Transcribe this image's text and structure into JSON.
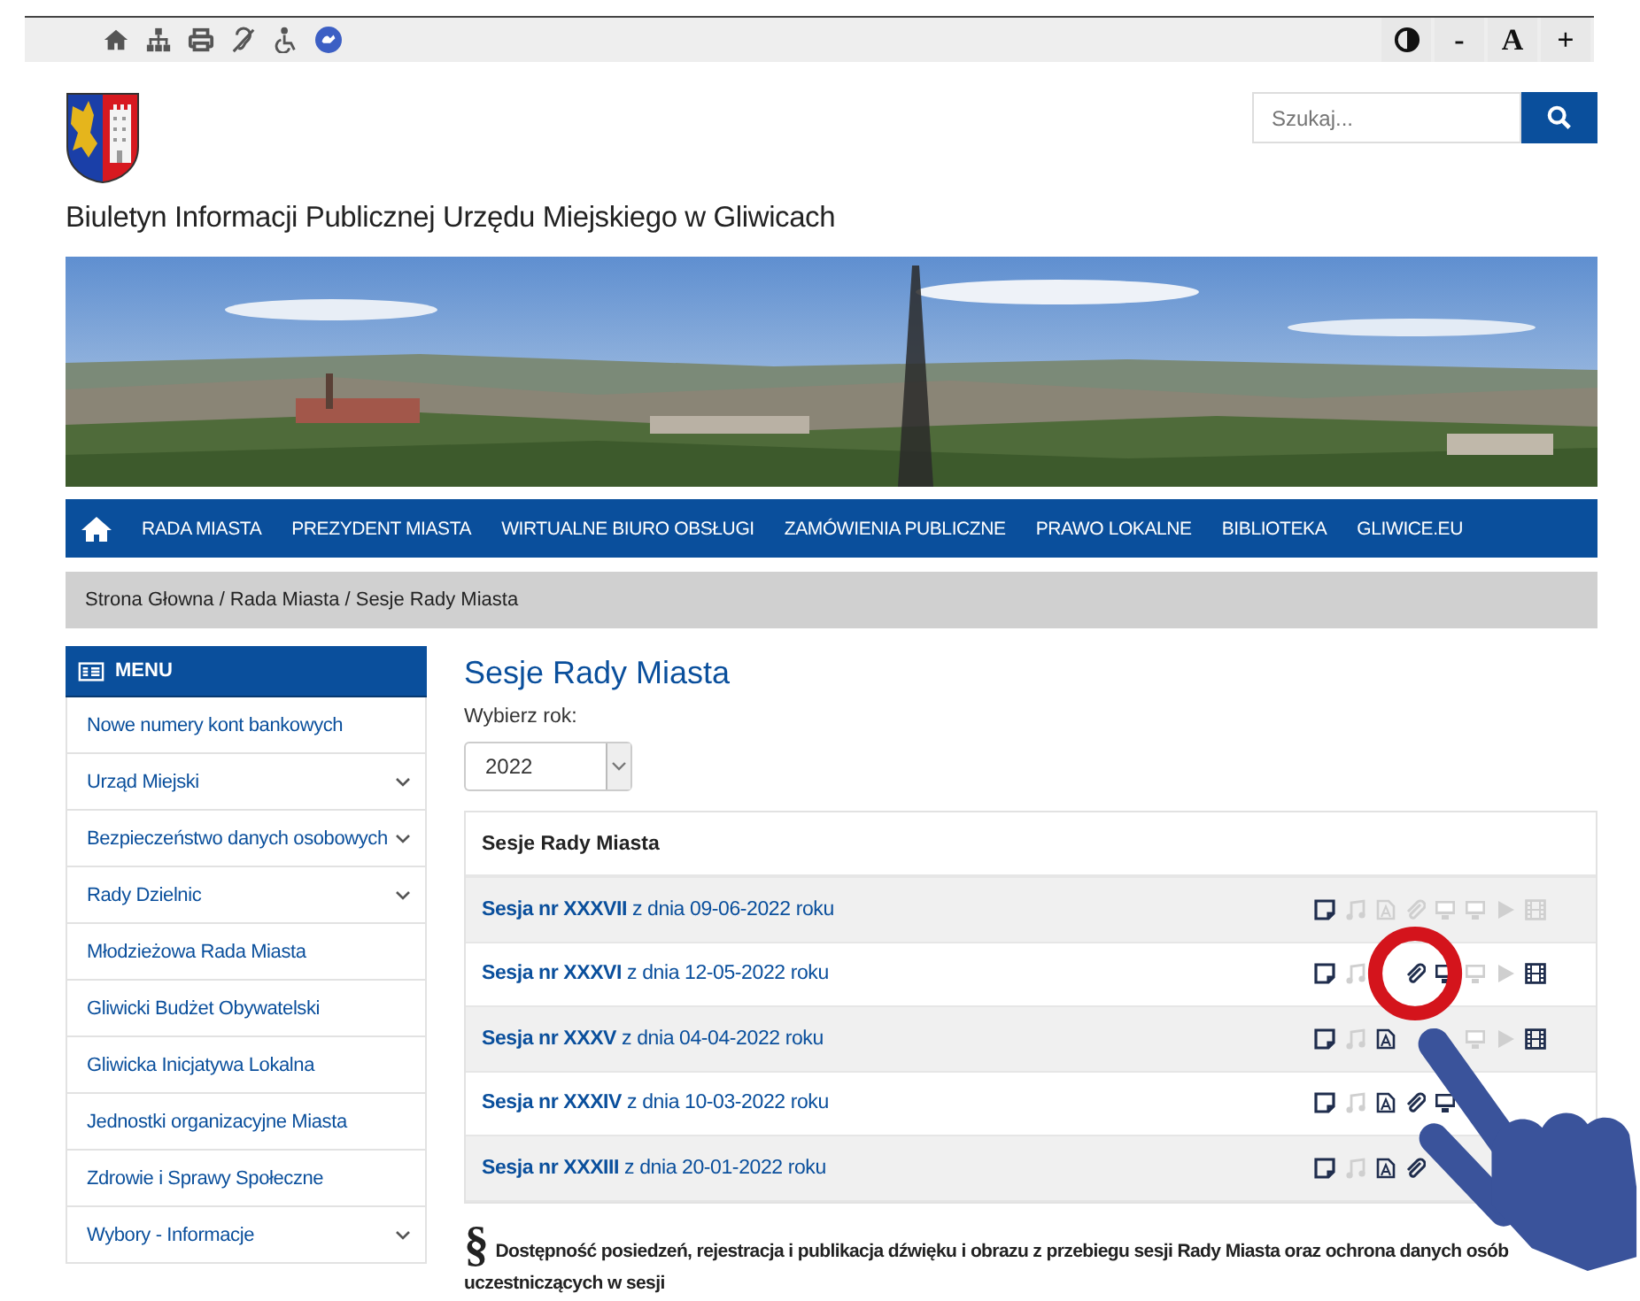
{
  "accessibility_bar": {
    "font_controls": [
      "-",
      "A",
      "+"
    ]
  },
  "search": {
    "placeholder": "Szukaj..."
  },
  "site_title": "Biuletyn Informacji Publicznej Urzędu Miejskiego w Gliwicach",
  "nav": {
    "items": [
      "RADA MIASTA",
      "PREZYDENT MIASTA",
      "WIRTUALNE BIURO OBSŁUGI",
      "ZAMÓWIENIA PUBLICZNE",
      "PRAWO LOKALNE",
      "BIBLIOTEKA",
      "GLIWICE.EU"
    ]
  },
  "breadcrumb": "Strona Głowna / Rada Miasta / Sesje Rady Miasta",
  "sidebar": {
    "title": "MENU",
    "items": [
      {
        "label": "Nowe numery kont bankowych",
        "expandable": false
      },
      {
        "label": "Urząd Miejski",
        "expandable": true
      },
      {
        "label": "Bezpieczeństwo danych osobowych",
        "expandable": true
      },
      {
        "label": "Rady Dzielnic",
        "expandable": true
      },
      {
        "label": "Młodzieżowa Rada Miasta",
        "expandable": false
      },
      {
        "label": "Gliwicki Budżet Obywatelski",
        "expandable": false
      },
      {
        "label": "Gliwicka Inicjatywa Lokalna",
        "expandable": false
      },
      {
        "label": "Jednostki organizacyjne Miasta",
        "expandable": false
      },
      {
        "label": "Zdrowie i Sprawy Społeczne",
        "expandable": false
      },
      {
        "label": "Wybory - Informacje",
        "expandable": true
      }
    ]
  },
  "main": {
    "heading": "Sesje Rady Miasta",
    "year_label": "Wybierz rok:",
    "year": "2022",
    "table": {
      "header": "Sesje Rady Miasta",
      "rows": [
        {
          "title": "**Sesja nr XXXVII** z dnia 09-06-2022 roku",
          "icons": [
            {
              "kind": "note",
              "active": true
            },
            {
              "kind": "music",
              "active": false
            },
            {
              "kind": "pdf",
              "active": false
            },
            {
              "kind": "clip",
              "active": false
            },
            {
              "kind": "monitor",
              "active": false
            },
            {
              "kind": "monitor",
              "active": false
            },
            {
              "kind": "play",
              "active": false
            },
            {
              "kind": "film",
              "active": false
            }
          ]
        },
        {
          "title": "**Sesja nr XXXVI** z dnia 12-05-2022 roku",
          "icons": [
            {
              "kind": "note",
              "active": true
            },
            {
              "kind": "music",
              "active": false
            },
            {
              "kind": "hidden"
            },
            {
              "kind": "clip",
              "active": true
            },
            {
              "kind": "monitor",
              "active": true
            },
            {
              "kind": "monitor",
              "active": false
            },
            {
              "kind": "play",
              "active": false
            },
            {
              "kind": "film",
              "active": true
            }
          ]
        },
        {
          "title": "**Sesja nr XXXV** z dnia 04-04-2022 roku",
          "icons": [
            {
              "kind": "note",
              "active": true
            },
            {
              "kind": "music",
              "active": false
            },
            {
              "kind": "pdf",
              "active": true
            },
            {
              "kind": "hidden"
            },
            {
              "kind": "hidden"
            },
            {
              "kind": "monitor",
              "active": false
            },
            {
              "kind": "play",
              "active": false
            },
            {
              "kind": "film",
              "active": true
            }
          ]
        },
        {
          "title": "**Sesja nr XXXIV** z dnia 10-03-2022 roku",
          "icons": [
            {
              "kind": "note",
              "active": true
            },
            {
              "kind": "music",
              "active": false
            },
            {
              "kind": "pdf",
              "active": true
            },
            {
              "kind": "clip",
              "active": true
            },
            {
              "kind": "monitor",
              "active": true
            }
          ]
        },
        {
          "title": "**Sesja nr XXXIII** z dnia 20-01-2022 roku",
          "icons": [
            {
              "kind": "note",
              "active": true
            },
            {
              "kind": "music",
              "active": false
            },
            {
              "kind": "pdf",
              "active": true
            },
            {
              "kind": "clip",
              "active": true
            }
          ]
        }
      ]
    },
    "notice": {
      "mark": "§",
      "text": "Dostępność posiedzeń, rejestracja i publikacja dźwięku i obrazu z przebiegu sesji Rady Miasta oraz ochrona danych osób uczestniczących w sesji"
    }
  }
}
